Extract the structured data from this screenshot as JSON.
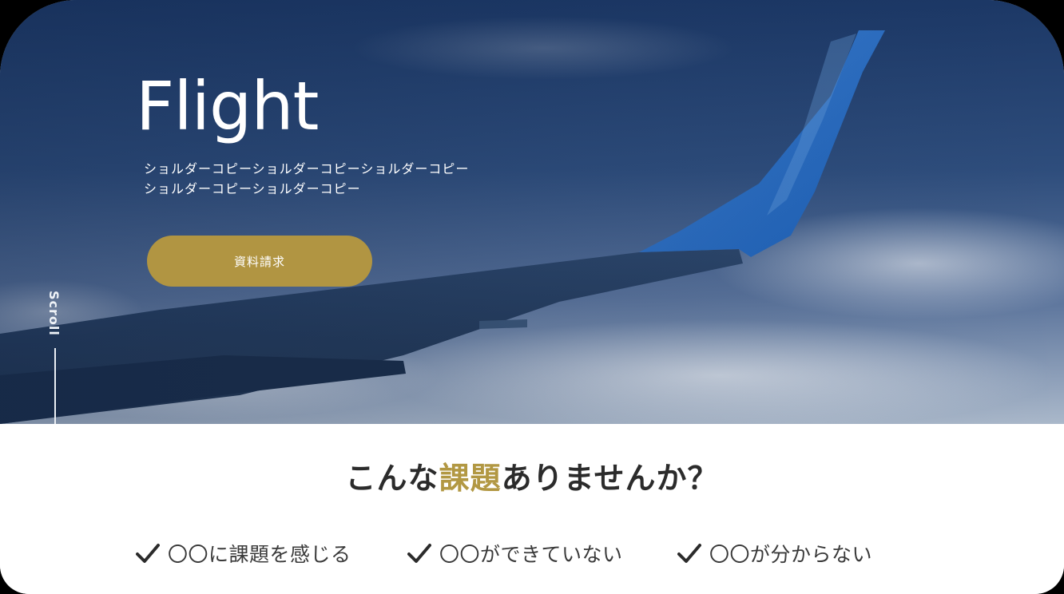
{
  "hero": {
    "title": "Flight",
    "subtitle_lines": [
      "ショルダーコピーショルダーコピーショルダーコピー",
      "ショルダーコピーショルダーコピー"
    ],
    "cta_label": "資料請求",
    "scroll_label": "Scroll"
  },
  "problems": {
    "heading_before": "こんな",
    "heading_accent": "課題",
    "heading_after": "ありませんか？",
    "items": [
      {
        "icon": "check-icon",
        "text": "〇〇に課題を感じる"
      },
      {
        "icon": "check-icon",
        "text": "〇〇ができていない"
      },
      {
        "icon": "check-icon",
        "text": "〇〇が分からない"
      }
    ]
  },
  "colors": {
    "accent_gold": "#b19542",
    "hero_sky": "#2c4a78",
    "text_dark": "#2b2b2b",
    "background": "#ffffff"
  }
}
